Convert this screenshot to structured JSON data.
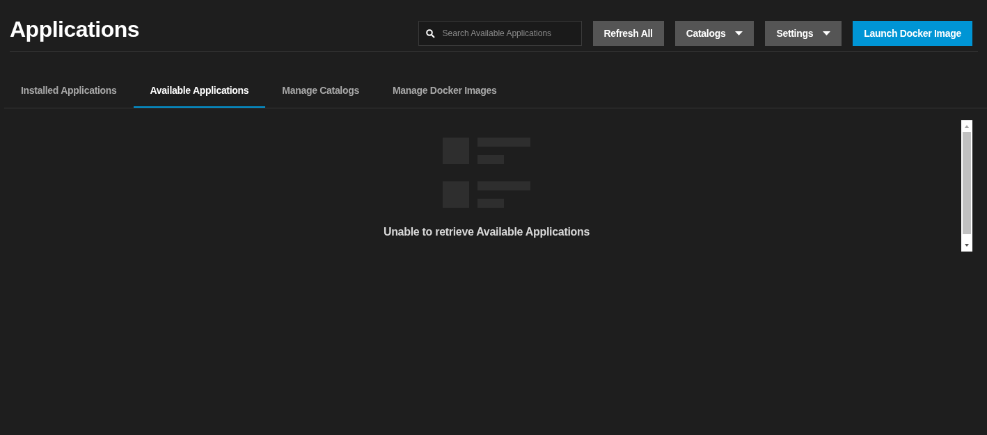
{
  "page": {
    "title": "Applications"
  },
  "search": {
    "placeholder": "Search Available Applications"
  },
  "buttons": [
    {
      "label": "Refresh All",
      "kind": "plain"
    },
    {
      "label": "Catalogs",
      "kind": "dropdown"
    },
    {
      "label": "Settings",
      "kind": "dropdown"
    },
    {
      "label": "Launch Docker Image",
      "kind": "primary"
    }
  ],
  "tabs": [
    {
      "label": "Installed Applications",
      "selected": false
    },
    {
      "label": "Available Applications",
      "selected": true
    },
    {
      "label": "Manage Catalogs",
      "selected": false
    },
    {
      "label": "Manage Docker Images",
      "selected": false
    }
  ],
  "empty_state": {
    "message": "Unable to retrieve Available Applications"
  }
}
